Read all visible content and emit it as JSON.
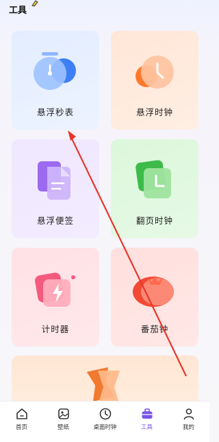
{
  "header": {
    "title": "工具"
  },
  "cards": {
    "stopwatch": "悬浮秒表",
    "clock": "悬浮时钟",
    "sticky": "悬浮便签",
    "flip": "翻页时钟",
    "timer": "计时器",
    "pomodoro": "番茄钟"
  },
  "tabs": [
    {
      "label": "首页",
      "icon": "home-icon"
    },
    {
      "label": "壁纸",
      "icon": "wallpaper-icon"
    },
    {
      "label": "桌面时钟",
      "icon": "clock-icon"
    },
    {
      "label": "工具",
      "icon": "toolbox-icon",
      "active": true
    },
    {
      "label": "我的",
      "icon": "profile-icon"
    }
  ],
  "colors": {
    "accent": "#7a55e8",
    "annotation_arrow": "#e8362b"
  }
}
